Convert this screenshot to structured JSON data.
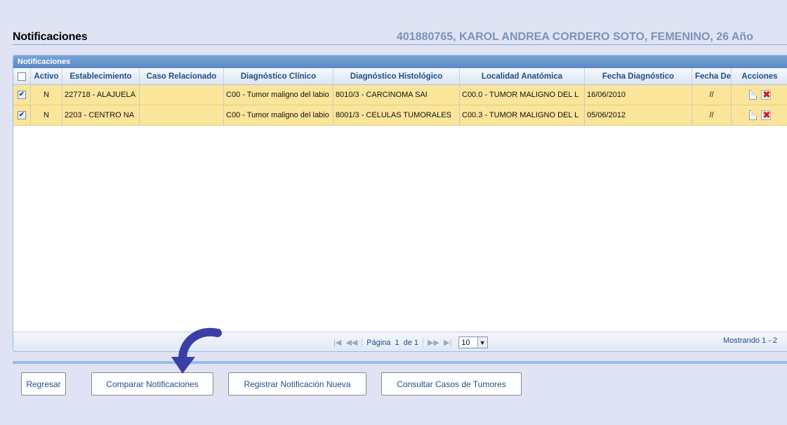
{
  "header": {
    "title": "Notificaciones",
    "patient": "401880765, KAROL ANDREA CORDERO SOTO, FEMENINO, 26 Año"
  },
  "grid": {
    "caption": "Notificaciones",
    "columns": [
      "Activo",
      "Establecimiento",
      "Caso Relacionado",
      "Diagnóstico Clínico",
      "Diagnóstico Histológico",
      "Localidad Anatómica",
      "Fecha Diagnóstico",
      "Fecha De",
      "Acciones"
    ],
    "rows": [
      {
        "checked": true,
        "activo": "N",
        "establecimiento": "227718 - ALAJUELA",
        "caso": "",
        "clinico": "C00 - Tumor maligno del labio",
        "histologico": "8010/3 - CARCINOMA SAI",
        "localidad": "C00.0 - TUMOR MALIGNO DEL L",
        "fecha_diag": "16/06/2010",
        "fecha_de": "//"
      },
      {
        "checked": true,
        "activo": "N",
        "establecimiento": "2203 - CENTRO NA",
        "caso": "",
        "clinico": "C00 - Tumor maligno del labio",
        "histologico": "8001/3 - CELULAS TUMORALES",
        "localidad": "C00.3 - TUMOR MALIGNO DEL L",
        "fecha_diag": "05/06/2012",
        "fecha_de": "//"
      }
    ]
  },
  "pager": {
    "page_label": "Página",
    "page": "1",
    "of_label": "de 1",
    "page_size": "10",
    "showing": "Mostrando 1 - 2"
  },
  "buttons": {
    "back": "Regresar",
    "compare": "Comparar Notificaciones",
    "register": "Registrar Notificación Nueva",
    "consult": "Consultar Casos de Tumores"
  },
  "icons": {
    "checkbox_checked": "check-icon",
    "view": "document-icon",
    "delete": "delete-icon",
    "annotation": "curved-arrow-icon"
  },
  "colors": {
    "background": "#dfe3f3",
    "row_highlight": "#fbe59a",
    "header_text": "#1f4e88",
    "accent": "#5b88c4",
    "annotation_arrow": "#3a3fa8"
  }
}
